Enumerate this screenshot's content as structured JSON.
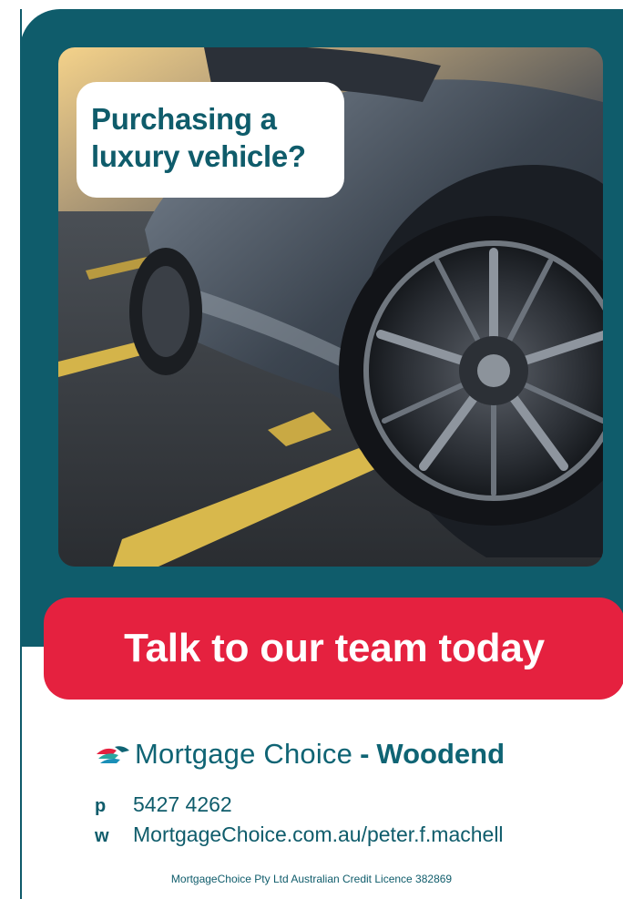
{
  "callout": {
    "line1": "Purchasing a",
    "line2": "luxury vehicle?"
  },
  "cta": {
    "label": "Talk to our team today"
  },
  "brand": {
    "name": "Mortgage Choice",
    "separator": "-",
    "branch": "Woodend",
    "logo_icon": "mortgage-choice-bird-icon"
  },
  "contact": {
    "phone_key": "p",
    "phone": "5427 4262",
    "web_key": "w",
    "website": "MortgageChoice.com.au/peter.f.machell"
  },
  "legal": "MortgageChoice Pty Ltd Australian Credit Licence 382869",
  "colors": {
    "teal": "#0f5c6b",
    "red": "#e5213f",
    "white": "#ffffff"
  }
}
